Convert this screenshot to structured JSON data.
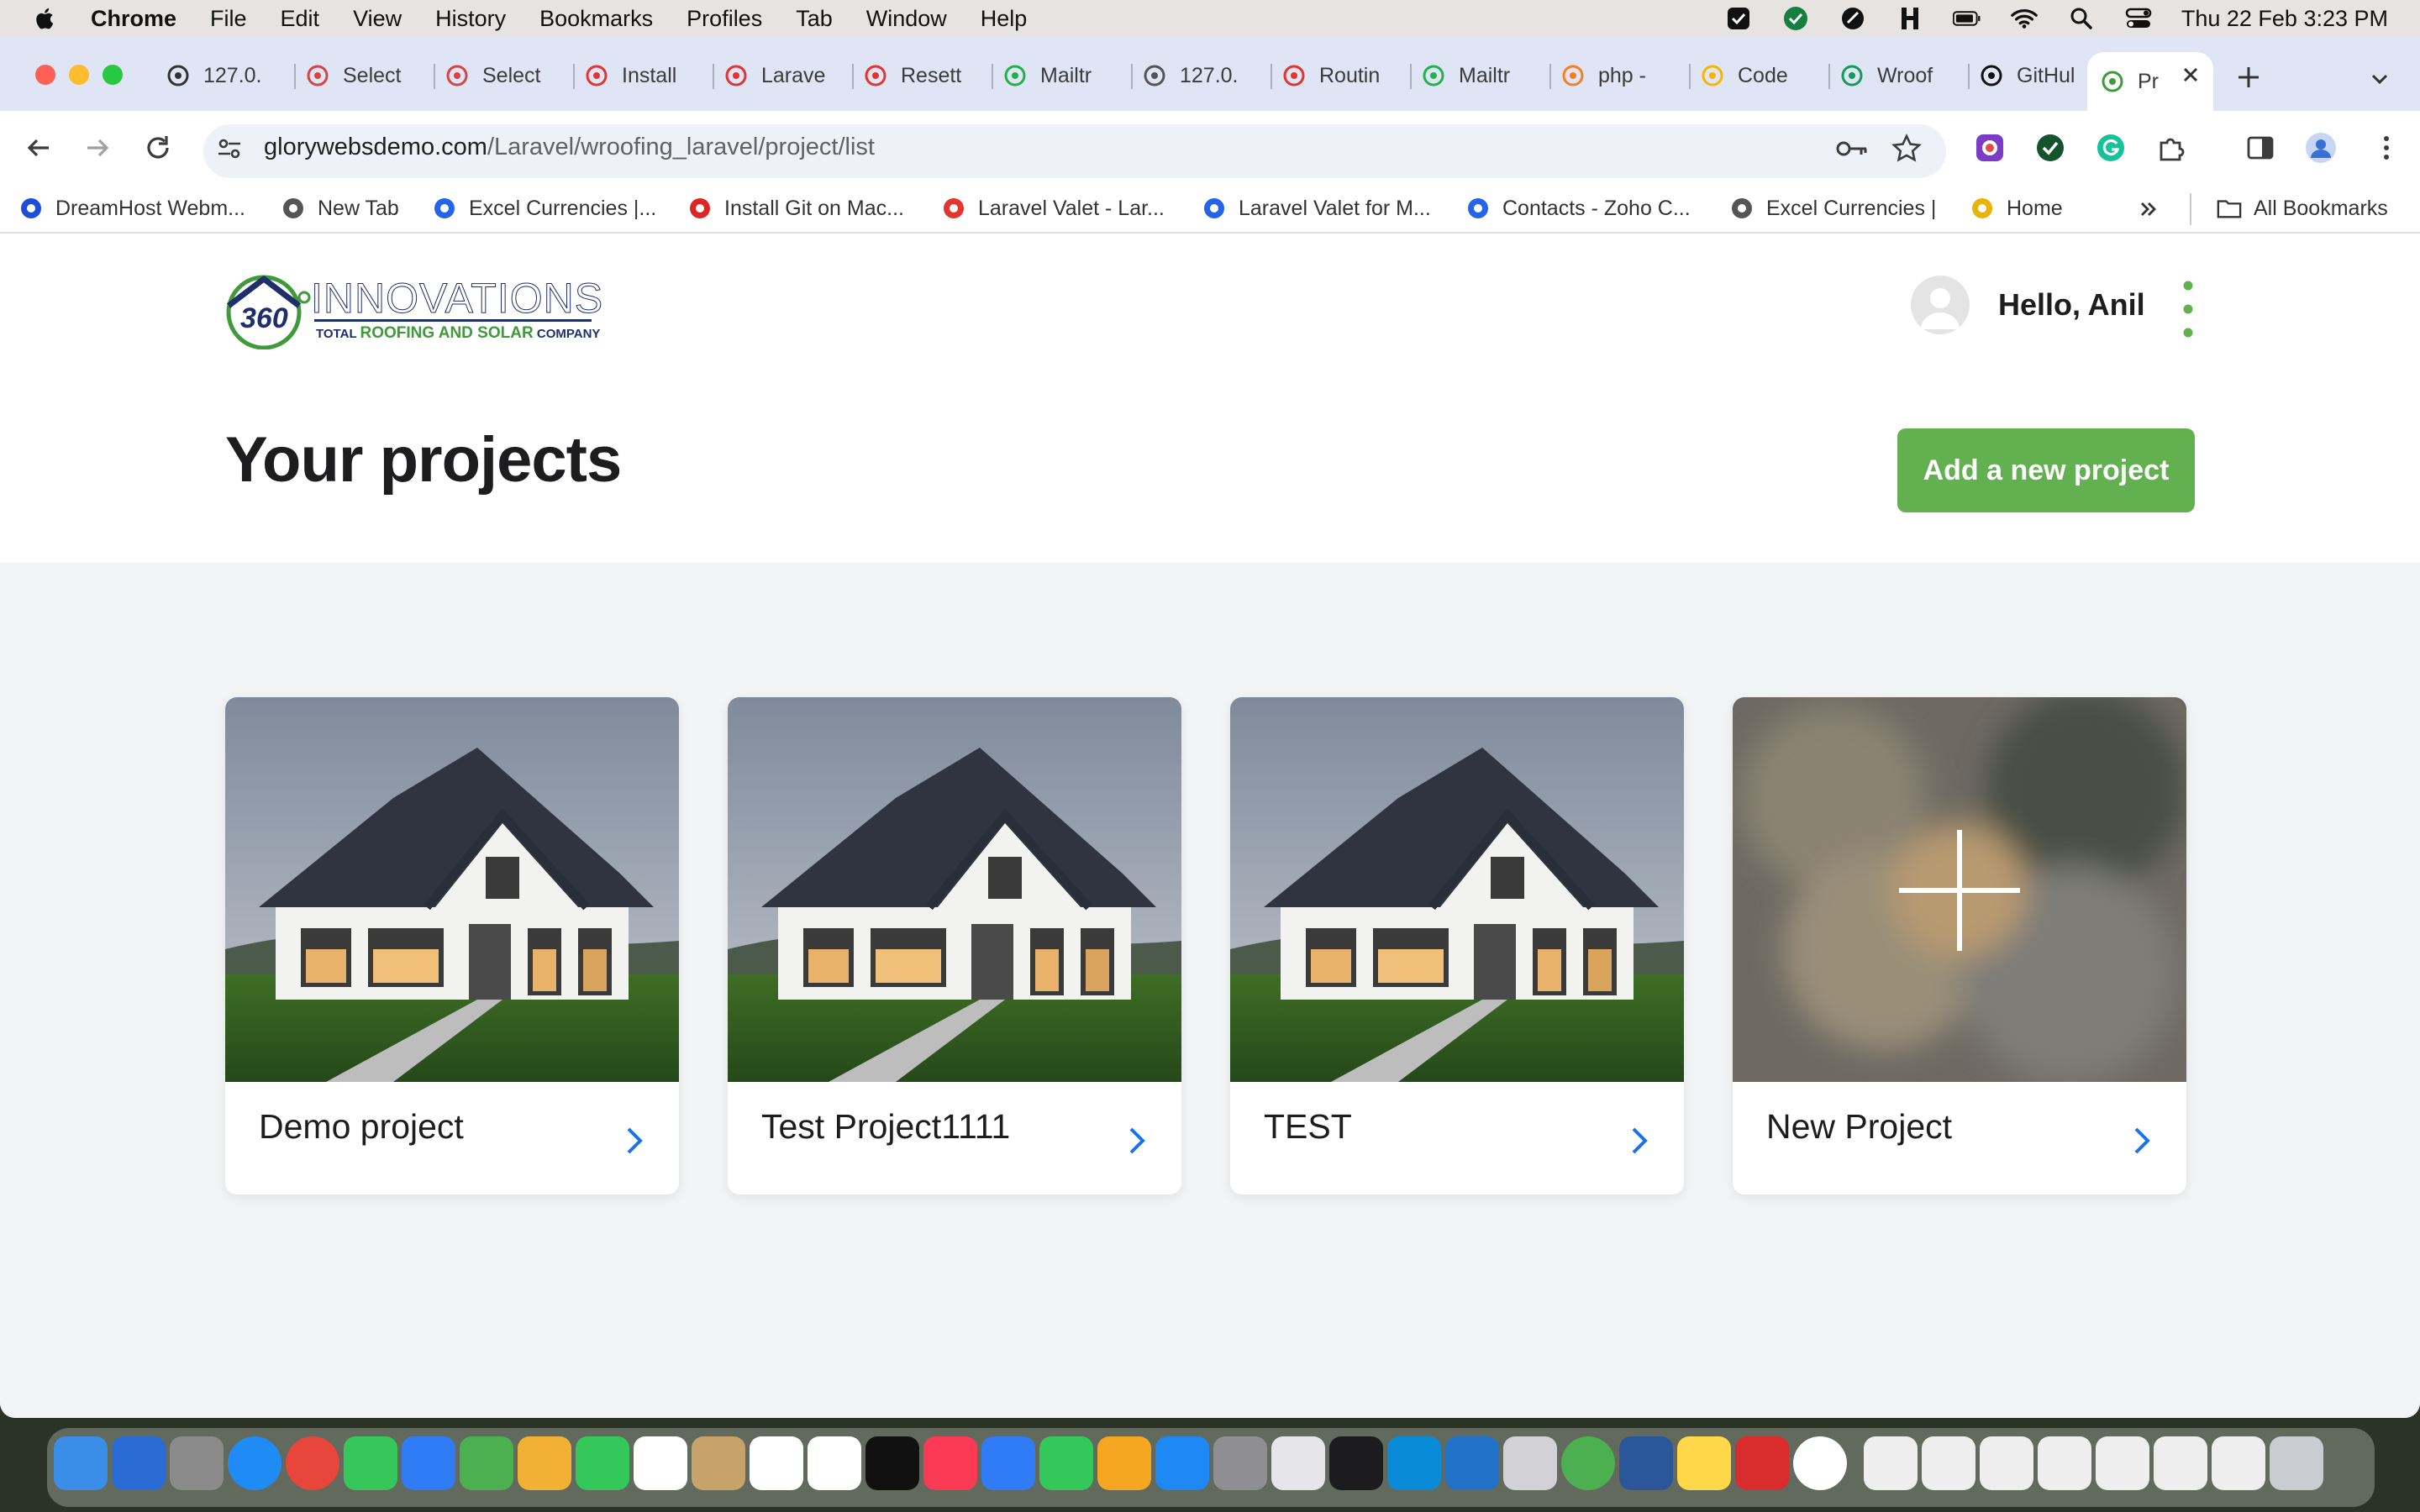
{
  "menubar": {
    "app": "Chrome",
    "items": [
      "File",
      "Edit",
      "View",
      "History",
      "Bookmarks",
      "Profiles",
      "Tab",
      "Window",
      "Help"
    ],
    "clock": "Thu 22 Feb  3:23 PM"
  },
  "tabs": [
    {
      "label": "127.0.",
      "icon": "app-icon"
    },
    {
      "label": "Select",
      "icon": "db-icon"
    },
    {
      "label": "Select",
      "icon": "db-icon"
    },
    {
      "label": "Install",
      "icon": "laravel-icon"
    },
    {
      "label": "Larave",
      "icon": "laravel-icon"
    },
    {
      "label": "Resett",
      "icon": "laravel-icon"
    },
    {
      "label": "Mailtr",
      "icon": "mailtrap-icon"
    },
    {
      "label": "127.0.",
      "icon": "globe-icon"
    },
    {
      "label": "Routin",
      "icon": "laravel-icon"
    },
    {
      "label": "Mailtr",
      "icon": "mailtrap-icon"
    },
    {
      "label": "php -",
      "icon": "stackoverflow-icon"
    },
    {
      "label": "Code",
      "icon": "code-icon"
    },
    {
      "label": "Wroof",
      "icon": "sheets-icon"
    },
    {
      "label": "GitHul",
      "icon": "github-icon"
    },
    {
      "label": "Pr",
      "icon": "site-icon"
    }
  ],
  "address": {
    "domain": "glorywebsdemo.com",
    "path": "/Laravel/wroofing_laravel/project/list"
  },
  "bookmarks": [
    {
      "label": "DreamHost Webm...",
      "icon": "dreamhost-icon"
    },
    {
      "label": "New Tab",
      "icon": "globe-icon"
    },
    {
      "label": "Excel Currencies |...",
      "icon": "excel-currencies-icon"
    },
    {
      "label": "Install Git on Mac...",
      "icon": "git-icon"
    },
    {
      "label": "Laravel Valet - Lar...",
      "icon": "laravel-icon"
    },
    {
      "label": "Laravel Valet for M...",
      "icon": "valet-icon"
    },
    {
      "label": "Contacts - Zoho C...",
      "icon": "zoho-icon"
    },
    {
      "label": "Excel Currencies |",
      "icon": "globe-icon"
    },
    {
      "label": "Home",
      "icon": "home-icon"
    }
  ],
  "bookmarks_all": "All Bookmarks",
  "site": {
    "logo_main": "INNOVATIONS",
    "logo_badge": "360",
    "logo_sub_1": "TOTAL ",
    "logo_sub_2": "ROOFING AND SOLAR",
    "logo_sub_3": " COMPANY",
    "greeting": "Hello, Anil",
    "page_title": "Your projects",
    "add_button": "Add a new project"
  },
  "projects": [
    {
      "name": "Demo project",
      "image": "house"
    },
    {
      "name": "Test Project1111",
      "image": "house"
    },
    {
      "name": "TEST",
      "image": "house"
    },
    {
      "name": "New Project",
      "image": "blurred-add"
    }
  ],
  "colors": {
    "accent_green": "#62b050",
    "link_blue": "#1a73e8",
    "logo_navy": "#1f2f6b"
  }
}
